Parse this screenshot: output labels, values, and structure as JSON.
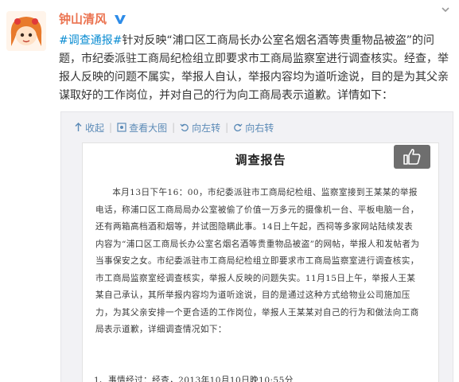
{
  "post": {
    "username": "钟山清风",
    "hashtag": "#调查通报#",
    "body": "针对反映“浦口区工商局长办公室名烟名酒等贵重物品被盗”的问题，市纪委派驻工商局纪检组立即要求市工商局监察室进行调查核实。经查，举报人反映的问题不属实，举报人自认，举报内容均为道听途说，目的是为其父亲谋取好的工作岗位，并对自己的行为向工商局表示道歉。详情如下："
  },
  "toolbar": {
    "collapse_label": "收起",
    "view_large_label": "查看大图",
    "rotate_left_label": "向左转",
    "rotate_right_label": "向右转"
  },
  "document": {
    "title": "调查报告",
    "body": "本月13日下午16：00，市纪委派驻市工商局纪检组、监察室接到王某某的举报电话，称浦口区工商局局办公室被偷了价值一万多元的摄像机一台、平板电脑一台，还有两箱高档酒和烟等，并试图隐瞒此事。14日上午起，西祠等多家网站陆续发表内容为“浦口区工商局长办公室名烟名酒等贵重物品被盗”的网帖，举报人和发帖者为当事保安之女。市纪委派驻市工商局纪检组立即要求市工商局监察室进行调查核实，市工商局监察室经调查核实，举报人反映的问题失实。11月15日上午，举报人王某某自己承认，其所举报内容均为道听途说，目的是通过这种方式给物业公司施加压力，为其父亲安排一个更合适的工作岗位，举报人王某某对自己的行为和做法向工商局表示道歉，详细调查情况如下：",
    "item_line": "1、事情经过：经查，2013年10月10日晚10:55分"
  },
  "colors": {
    "username": "#eb7350",
    "hashtag": "#0a8cd2",
    "toolbar_link": "#5c8bb7",
    "verified_badge": "#2d8ce8"
  },
  "icons": [
    "user-avatar",
    "verified-v-icon",
    "dropdown-arrow-icon",
    "collapse-up-icon",
    "zoom-view-icon",
    "rotate-left-icon",
    "rotate-right-icon",
    "thumbs-up-icon"
  ]
}
